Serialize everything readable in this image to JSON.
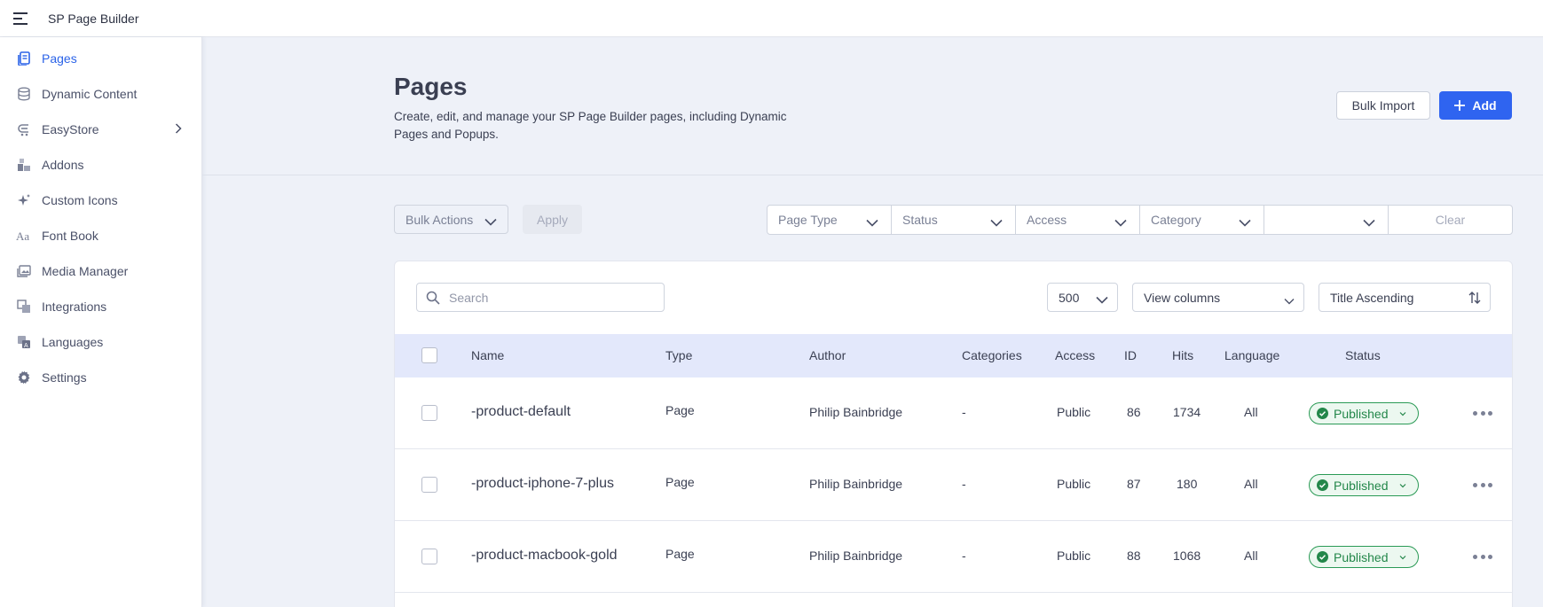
{
  "topbar": {
    "app_title": "SP Page Builder"
  },
  "sidebar": {
    "items": [
      {
        "label": "Pages",
        "icon": "pages-icon",
        "active": true
      },
      {
        "label": "Dynamic Content",
        "icon": "database-icon"
      },
      {
        "label": "EasyStore",
        "icon": "store-icon",
        "has_submenu": true
      },
      {
        "label": "Addons",
        "icon": "addons-icon"
      },
      {
        "label": "Custom Icons",
        "icon": "sparkle-icon"
      },
      {
        "label": "Font Book",
        "icon": "font-icon"
      },
      {
        "label": "Media Manager",
        "icon": "media-icon"
      },
      {
        "label": "Integrations",
        "icon": "integrations-icon"
      },
      {
        "label": "Languages",
        "icon": "languages-icon"
      },
      {
        "label": "Settings",
        "icon": "gear-icon"
      }
    ]
  },
  "header": {
    "title": "Pages",
    "description": "Create, edit, and manage your SP Page Builder pages, including Dynamic Pages and Popups.",
    "bulk_import_label": "Bulk Import",
    "add_label": "Add"
  },
  "filters": {
    "bulk_actions": "Bulk Actions",
    "apply": "Apply",
    "page_type": "Page Type",
    "status": "Status",
    "access": "Access",
    "category": "Category",
    "extra": "",
    "clear": "Clear"
  },
  "toolbar": {
    "search_placeholder": "Search",
    "per_page": "500",
    "view_columns": "View columns",
    "sort": "Title Ascending"
  },
  "table": {
    "columns": [
      "Name",
      "Type",
      "Author",
      "Categories",
      "Access",
      "ID",
      "Hits",
      "Language",
      "Status"
    ],
    "rows": [
      {
        "name": "-product-default",
        "type": "Page",
        "author": "Philip Bainbridge",
        "categories": "-",
        "access": "Public",
        "id": "86",
        "hits": "1734",
        "language": "All",
        "status": "Published"
      },
      {
        "name": "-product-iphone-7-plus",
        "type": "Page",
        "author": "Philip Bainbridge",
        "categories": "-",
        "access": "Public",
        "id": "87",
        "hits": "180",
        "language": "All",
        "status": "Published"
      },
      {
        "name": "-product-macbook-gold",
        "type": "Page",
        "author": "Philip Bainbridge",
        "categories": "-",
        "access": "Public",
        "id": "88",
        "hits": "1068",
        "language": "All",
        "status": "Published"
      }
    ]
  },
  "colors": {
    "accent": "#2f64f0",
    "published": "#23874a",
    "header_bg": "#e3e8fb",
    "page_bg": "#eef1f8"
  }
}
